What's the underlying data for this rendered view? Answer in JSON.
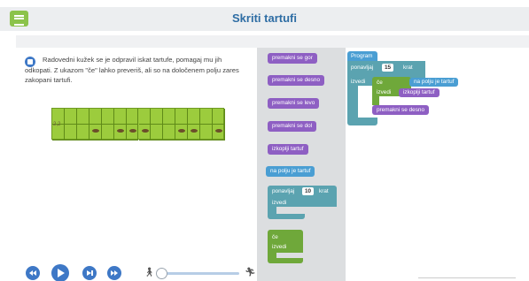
{
  "header": {
    "title": "Skriti tartufi"
  },
  "instructions": {
    "text": "Radovedni kužek se je odpravil iskat tartufe, pomagaj mu jih odkopati. Z ukazom \"če\" lahko preveriš, ali so na določenem polju zares zakopani tartufi."
  },
  "game": {
    "pig_label": "2,2"
  },
  "toolbox": {
    "move_up": "premakni se gor",
    "move_right": "premakni se desno",
    "move_left": "premakni se levo",
    "move_down": "premakni se dol",
    "dig": "izkoplji tartuf",
    "on_truffle": "na polju je tartuf",
    "repeat_label": "ponavljaj",
    "repeat_count": "10",
    "repeat_suffix": "krat",
    "repeat_do": "izvedi",
    "if_label": "če",
    "if_do": "izvedi"
  },
  "workspace": {
    "program_label": "Program",
    "repeat_label": "ponavljaj",
    "repeat_count": "15",
    "repeat_suffix": "krat",
    "repeat_do": "izvedi",
    "if_label": "če",
    "condition": "na polju je tartuf",
    "if_do": "izvedi",
    "dig": "izkoplji tartuf",
    "move_right": "premakni se desno"
  }
}
